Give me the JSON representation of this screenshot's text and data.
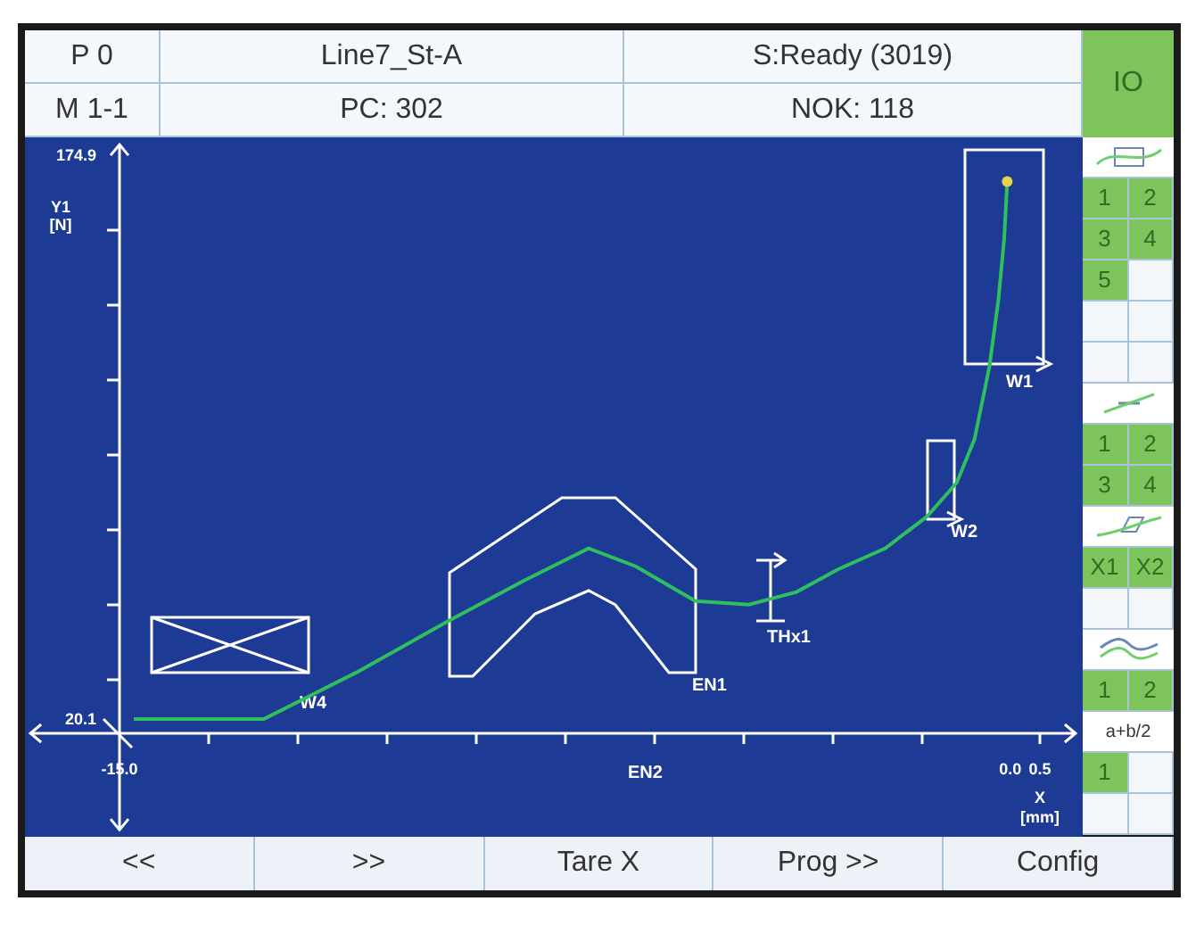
{
  "header": {
    "cells": [
      {
        "text": "P 0"
      },
      {
        "text": "Line7_St-A"
      },
      {
        "text": "S:Ready (3019)"
      },
      {
        "text": "M 1-1"
      },
      {
        "text": "PC: 302"
      },
      {
        "text": "NOK: 118"
      }
    ],
    "io_button": "IO"
  },
  "chart": {
    "chart_data": {
      "type": "line",
      "xlabel": "X [mm]",
      "ylabel": "Y1 [N]",
      "xlim": [
        -16.5,
        1.1
      ],
      "ylim": [
        -10.3,
        177.8
      ],
      "xticks": [
        {
          "value": -15.0,
          "label": "-15.0"
        },
        {
          "value": 0.0,
          "label": "0.0"
        },
        {
          "value": 0.5,
          "label": "0.5"
        }
      ],
      "yticks": [
        {
          "value": 20.1,
          "label": "20.1"
        },
        {
          "value": 174.9,
          "label": "174.9"
        }
      ],
      "x": [
        -14.76,
        -12.57,
        -11,
        -9.5,
        -8.2,
        -7.1,
        -6.3,
        -5.3,
        -4.4,
        -3.6,
        -2.9,
        -2.1,
        -1.4,
        -0.9,
        -0.6,
        -0.35,
        -0.2,
        -0.1,
        -0.05
      ],
      "series": [
        {
          "color": "#2fbf5f",
          "values": [
            20.1,
            20.1,
            33,
            46.7,
            58,
            67,
            62,
            52.5,
            51.5,
            55,
            61.2,
            67,
            75.7,
            85,
            97,
            116.9,
            135,
            152,
            167.7
          ]
        }
      ]
    },
    "evaluation_objects": [
      {
        "kind": "window",
        "label": "W1"
      },
      {
        "kind": "window",
        "label": "W2"
      },
      {
        "kind": "window_cross",
        "label": "W4"
      },
      {
        "kind": "envelope",
        "label": "EN1"
      },
      {
        "kind": "axis_marker",
        "label": "EN2"
      },
      {
        "kind": "threshold",
        "label": "THx1"
      }
    ]
  },
  "sidebar": {
    "sections": [
      {
        "kind": "window",
        "rows": [
          {
            "kind": "cells",
            "cells": [
              {
                "label": "1",
                "active": true
              },
              {
                "label": "2",
                "active": true
              }
            ]
          },
          {
            "kind": "cells",
            "cells": [
              {
                "label": "3",
                "active": true
              },
              {
                "label": "4",
                "active": true
              }
            ]
          },
          {
            "kind": "cells",
            "cells": [
              {
                "label": "5",
                "active": true
              },
              {
                "active": false
              }
            ]
          },
          {
            "kind": "cells",
            "cells": [
              {
                "active": false
              },
              {
                "active": false
              }
            ]
          },
          {
            "kind": "cells",
            "cells": [
              {
                "active": false
              },
              {
                "active": false
              }
            ]
          }
        ]
      },
      {
        "kind": "line",
        "rows": [
          {
            "kind": "cells",
            "cells": [
              {
                "label": "1",
                "active": true
              },
              {
                "label": "2",
                "active": true
              }
            ]
          },
          {
            "kind": "cells",
            "cells": [
              {
                "label": "3",
                "active": true
              },
              {
                "label": "4",
                "active": true
              }
            ]
          }
        ]
      },
      {
        "kind": "envelope",
        "rows": [
          {
            "kind": "cells",
            "cells": [
              {
                "label": "X1",
                "active": true
              },
              {
                "label": "X2",
                "active": true
              }
            ]
          },
          {
            "kind": "cells",
            "cells": [
              {
                "active": false
              },
              {
                "active": false
              }
            ]
          }
        ]
      },
      {
        "kind": "wave",
        "rows": [
          {
            "kind": "cells",
            "cells": [
              {
                "label": "1",
                "active": true
              },
              {
                "label": "2",
                "active": true
              }
            ]
          },
          {
            "kind": "text",
            "text": "a+b/2"
          },
          {
            "kind": "cells",
            "cells": [
              {
                "label": "1",
                "active": true
              },
              {
                "active": false
              }
            ]
          },
          {
            "kind": "cells",
            "cells": [
              {
                "active": false
              },
              {
                "active": false
              }
            ]
          }
        ]
      }
    ]
  },
  "footer": {
    "buttons": [
      "<<",
      ">>",
      "Tare X",
      "Prog >>",
      "Config"
    ]
  }
}
